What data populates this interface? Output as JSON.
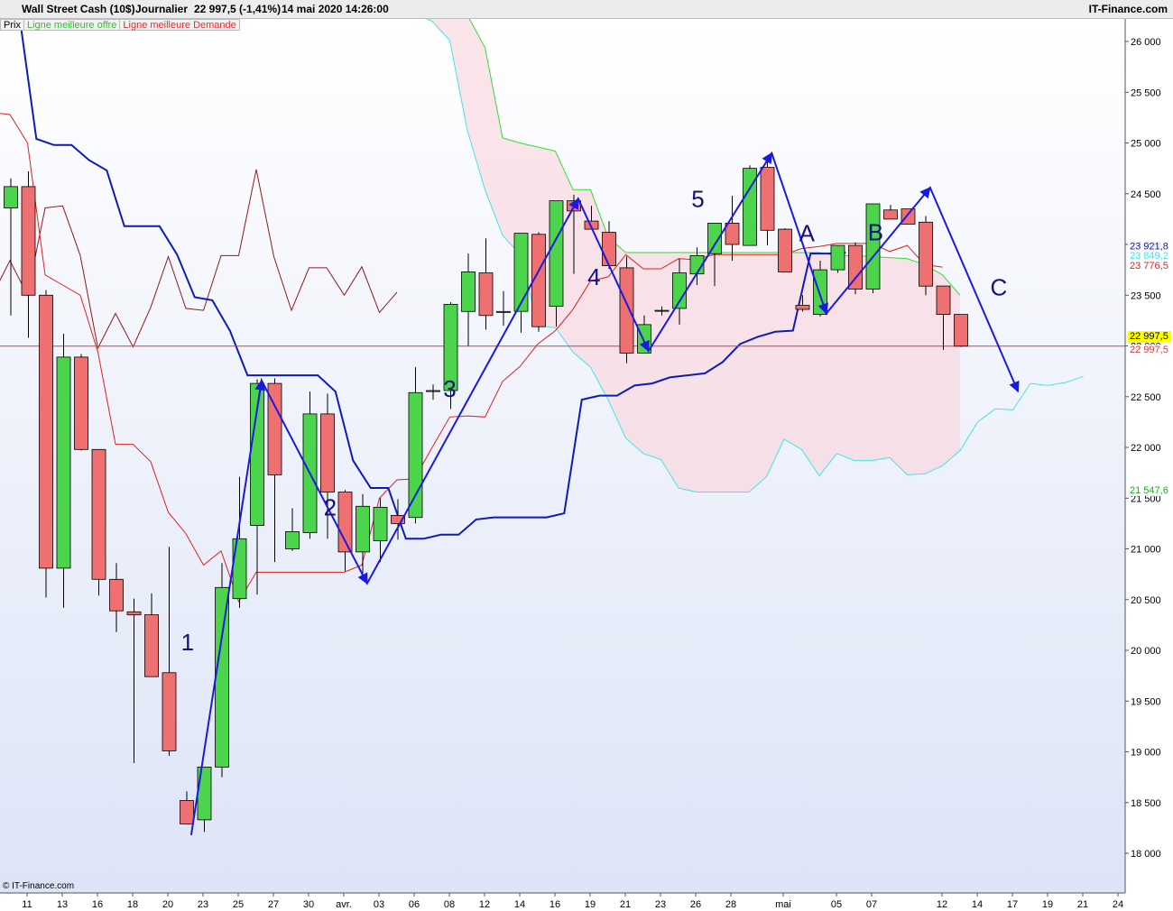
{
  "header": {
    "instrument": "Wall Street Cash (10$)",
    "period": "Journalier",
    "quote": "22 997,5 (-1,41%)",
    "timestamp": "14 mai 2020 14:26:00",
    "brand": "IT-Finance.com"
  },
  "legend": {
    "price": "Prix",
    "best_offer": "Ligne meilleure offre",
    "best_demand": "Ligne meilleure Demande"
  },
  "copyright": "© IT-Finance.com",
  "colors": {
    "up": "#4cd44c",
    "down": "#ee7070",
    "tenkan": "#e02020",
    "kijun": "#0d1bb8",
    "chikou": "#8b1a1a",
    "senkou_a": "#33dd33",
    "senkou_b": "#44e4e4",
    "cloud": "#f9d9df",
    "waves": "#1a1adf",
    "last_price_line": "#d04040"
  },
  "chart_data": {
    "type": "candlestick",
    "y_range": [
      17800,
      26200
    ],
    "x_ticks": [
      "11",
      "13",
      "16",
      "18",
      "20",
      "23",
      "25",
      "27",
      "30",
      "avr.",
      "03",
      "06",
      "08",
      "12",
      "14",
      "16",
      "19",
      "21",
      "23",
      "26",
      "28",
      "mai",
      "05",
      "07",
      "12",
      "14",
      "17",
      "19",
      "21",
      "24"
    ],
    "y_ticks": [
      "26 000",
      "25 500",
      "25 000",
      "24 500",
      "24 000",
      "23 500",
      "23 000",
      "22 500",
      "22 000",
      "21 500",
      "21 000",
      "20 500",
      "20 000",
      "19 500",
      "19 000",
      "18 500",
      "18 000"
    ],
    "candles": [
      {
        "o": 24360,
        "h": 24650,
        "l": 23300,
        "c": 24570
      },
      {
        "o": 24570,
        "h": 24720,
        "l": 23080,
        "c": 23500
      },
      {
        "o": 23500,
        "h": 23550,
        "l": 20520,
        "c": 20810
      },
      {
        "o": 20810,
        "h": 23120,
        "l": 20420,
        "c": 22890
      },
      {
        "o": 22890,
        "h": 22920,
        "l": 21970,
        "c": 21980
      },
      {
        "o": 21980,
        "h": 21980,
        "l": 20540,
        "c": 20700
      },
      {
        "o": 20700,
        "h": 20860,
        "l": 20180,
        "c": 20390
      },
      {
        "o": 20380,
        "h": 20510,
        "l": 18890,
        "c": 20350
      },
      {
        "o": 20350,
        "h": 20560,
        "l": 19910,
        "c": 19740
      },
      {
        "o": 19780,
        "h": 21020,
        "l": 18960,
        "c": 19010
      },
      {
        "o": 18520,
        "h": 18610,
        "l": 18300,
        "c": 18290
      },
      {
        "o": 18330,
        "h": 18850,
        "l": 18210,
        "c": 18850
      },
      {
        "o": 18850,
        "h": 20860,
        "l": 18750,
        "c": 20620
      },
      {
        "o": 20510,
        "h": 21710,
        "l": 20420,
        "c": 21100
      },
      {
        "o": 21230,
        "h": 22670,
        "l": 20550,
        "c": 22630
      },
      {
        "o": 22630,
        "h": 22680,
        "l": 20870,
        "c": 21730
      },
      {
        "o": 21000,
        "h": 21400,
        "l": 20980,
        "c": 21170
      },
      {
        "o": 21160,
        "h": 22550,
        "l": 21100,
        "c": 22330
      },
      {
        "o": 22330,
        "h": 22530,
        "l": 21100,
        "c": 21560
      },
      {
        "o": 21560,
        "h": 21580,
        "l": 20780,
        "c": 20970
      },
      {
        "o": 20970,
        "h": 21540,
        "l": 20730,
        "c": 21420
      },
      {
        "o": 21080,
        "h": 21500,
        "l": 20870,
        "c": 21410
      },
      {
        "o": 21330,
        "h": 21490,
        "l": 21090,
        "c": 21250
      },
      {
        "o": 21310,
        "h": 22790,
        "l": 21250,
        "c": 22540
      },
      {
        "o": 22550,
        "h": 22620,
        "l": 22470,
        "c": 22560
      },
      {
        "o": 22560,
        "h": 23430,
        "l": 22380,
        "c": 23410
      },
      {
        "o": 23340,
        "h": 23910,
        "l": 23000,
        "c": 23730
      },
      {
        "o": 23720,
        "h": 24060,
        "l": 23160,
        "c": 23300
      },
      {
        "o": 23330,
        "h": 23540,
        "l": 23200,
        "c": 23340
      },
      {
        "o": 23340,
        "h": 24100,
        "l": 23130,
        "c": 24110
      },
      {
        "o": 24100,
        "h": 24120,
        "l": 23140,
        "c": 23190
      },
      {
        "o": 23390,
        "h": 24070,
        "l": 23190,
        "c": 24430
      },
      {
        "o": 24430,
        "h": 24490,
        "l": 23710,
        "c": 24330
      },
      {
        "o": 24230,
        "h": 24380,
        "l": 24200,
        "c": 24150
      },
      {
        "o": 24120,
        "h": 24230,
        "l": 23760,
        "c": 23790
      },
      {
        "o": 23770,
        "h": 23880,
        "l": 22830,
        "c": 22930
      },
      {
        "o": 22930,
        "h": 23300,
        "l": 23070,
        "c": 23210
      },
      {
        "o": 23350,
        "h": 23390,
        "l": 23300,
        "c": 23350
      },
      {
        "o": 23370,
        "h": 23860,
        "l": 23210,
        "c": 23720
      },
      {
        "o": 23710,
        "h": 23970,
        "l": 23600,
        "c": 23890
      },
      {
        "o": 23910,
        "h": 23950,
        "l": 23590,
        "c": 24210
      },
      {
        "o": 24210,
        "h": 24480,
        "l": 23840,
        "c": 24000
      },
      {
        "o": 23990,
        "h": 24780,
        "l": 23990,
        "c": 24750
      },
      {
        "o": 24760,
        "h": 24880,
        "l": 23990,
        "c": 24140
      },
      {
        "o": 24150,
        "h": 24160,
        "l": 23830,
        "c": 23730
      },
      {
        "o": 23400,
        "h": 23500,
        "l": 23340,
        "c": 23360
      },
      {
        "o": 23310,
        "h": 23840,
        "l": 23290,
        "c": 23750
      },
      {
        "o": 23750,
        "h": 23960,
        "l": 23720,
        "c": 23990
      },
      {
        "o": 23990,
        "h": 24020,
        "l": 23510,
        "c": 23560
      },
      {
        "o": 23560,
        "h": 23990,
        "l": 23520,
        "c": 24400
      },
      {
        "o": 24340,
        "h": 24390,
        "l": 24290,
        "c": 24250
      },
      {
        "o": 24350,
        "h": 24350,
        "l": 24210,
        "c": 24200
      },
      {
        "o": 24220,
        "h": 24280,
        "l": 23500,
        "c": 23590
      },
      {
        "o": 23590,
        "h": 23440,
        "l": 22960,
        "c": 23310
      },
      {
        "o": 23310,
        "h": 23300,
        "l": 22990,
        "c": 22997.5
      }
    ],
    "tenkan_sen": [
      25300,
      25280,
      25000,
      23700,
      23600,
      23500,
      22940,
      22030,
      22030,
      21860,
      21360,
      21150,
      20840,
      20980,
      20480,
      20770,
      20770,
      20770,
      20770,
      20770,
      20770,
      20840,
      21500,
      21680,
      21690,
      22000,
      22300,
      22310,
      22300,
      22650,
      22800,
      23020,
      23150,
      23360,
      23640,
      23680,
      23900,
      23760,
      23760,
      23860,
      23850,
      23900,
      23900,
      23900,
      23900,
      23900,
      23960,
      23980,
      24010,
      24010,
      24010,
      23930,
      23990,
      23800,
      23776.8
    ],
    "kijun_sen": [
      26300,
      25040,
      24980,
      24980,
      24830,
      24730,
      24180,
      24180,
      24180,
      23900,
      23480,
      23450,
      23150,
      22710,
      22710,
      22710,
      22710,
      22710,
      22550,
      21870,
      21600,
      21600,
      21100,
      21100,
      21140,
      21140,
      21290,
      21310,
      21310,
      21310,
      21310,
      21350,
      22470,
      22510,
      22510,
      22610,
      22630,
      22690,
      22710,
      22730,
      22840,
      23020,
      23090,
      23140,
      23150,
      23910,
      23910,
      23919
    ],
    "chikou_span": [
      23500,
      23840,
      23500,
      24360,
      24380,
      23890,
      22980,
      23320,
      22990,
      23380,
      23880,
      23370,
      23350,
      23890,
      23890,
      24740,
      23880,
      23350,
      23770,
      23770,
      23500,
      23780,
      23330,
      23530
    ],
    "senkou_a": [
      26270,
      26270,
      26260,
      26260,
      25940,
      25050,
      25000,
      24960,
      24920,
      24540,
      24540,
      24070,
      23920,
      23920,
      23920,
      23920,
      23920,
      23920,
      23920,
      23920,
      23920,
      23920,
      23920,
      23920,
      23890,
      23890,
      23880,
      23870,
      23860,
      23800,
      23700,
      23500
    ],
    "senkou_b": [
      26270,
      26200,
      26010,
      25120,
      24540,
      24090,
      23900,
      23200,
      23180,
      22940,
      22790,
      22470,
      22090,
      21940,
      21880,
      21600,
      21560,
      21560,
      21560,
      21560,
      21710,
      22080,
      21980,
      21720,
      21940,
      21870,
      21870,
      21900,
      21730,
      21740,
      21820,
      21970,
      22250,
      22380,
      22370,
      22630,
      22610,
      22640,
      22700
    ],
    "last_price": 22997.5,
    "price_labels": [
      {
        "text": "23 921,8",
        "value": 23921.8,
        "color": "#0d1bb8"
      },
      {
        "text": "23 849,2",
        "value": 23849.2,
        "color": "#44e4e4"
      },
      {
        "text": "23 776,5",
        "value": 23776.5,
        "color": "#e02020"
      },
      {
        "text": "22 997,5",
        "value": 22997.5,
        "color": "#000000",
        "bg": "#ffff00"
      },
      {
        "text": "22 997,5",
        "value": 22997.5,
        "color": "#d04040"
      },
      {
        "text": "21 547,6",
        "value": 21547.6,
        "color": "#22aa22"
      }
    ],
    "wave_labels": [
      {
        "text": "1",
        "x": 10.1,
        "y": 20000
      },
      {
        "text": "2",
        "x": 18.2,
        "y": 21330
      },
      {
        "text": "3",
        "x": 25.0,
        "y": 22500
      },
      {
        "text": "4",
        "x": 33.2,
        "y": 23600
      },
      {
        "text": "5",
        "x": 39.1,
        "y": 24370
      },
      {
        "text": "A",
        "x": 45.3,
        "y": 24030
      },
      {
        "text": "B",
        "x": 49.2,
        "y": 24040
      },
      {
        "text": "C",
        "x": 56.2,
        "y": 23500
      }
    ],
    "wave_path": [
      {
        "x": 10.3,
        "y": 18180
      },
      {
        "x": 14.3,
        "y": 22660
      },
      {
        "x": 20.3,
        "y": 20660
      },
      {
        "x": 32.3,
        "y": 24450
      },
      {
        "x": 36.3,
        "y": 22950
      },
      {
        "x": 43.3,
        "y": 24900
      },
      {
        "x": 46.4,
        "y": 23320
      },
      {
        "x": 52.3,
        "y": 24560
      },
      {
        "x": 57.3,
        "y": 22550
      }
    ]
  }
}
